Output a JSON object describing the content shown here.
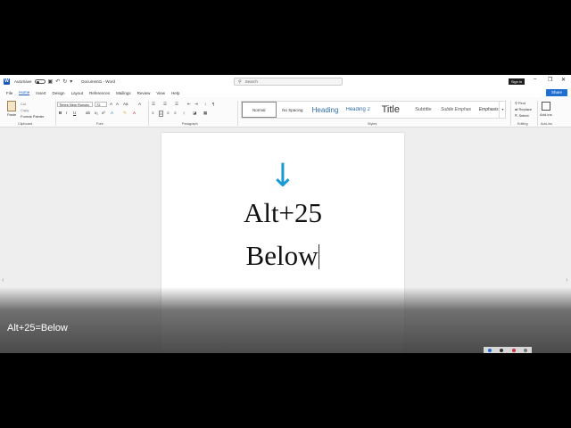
{
  "titlebar": {
    "autosave_label": "AutoSave",
    "doc_title": "Document1 - Word",
    "search_placeholder": "Search",
    "signin_label": "Sign in",
    "minimize": "–",
    "restore": "❐",
    "close": "✕"
  },
  "menu": {
    "items": [
      "File",
      "Home",
      "Insert",
      "Design",
      "Layout",
      "References",
      "Mailings",
      "Review",
      "View",
      "Help"
    ],
    "active": "Home",
    "share_label": "Share"
  },
  "ribbon": {
    "clipboard": {
      "paste": "Paste",
      "cut": "Cut",
      "copy": "Copy",
      "format_painter": "Format Painter",
      "group": "Clipboard"
    },
    "font": {
      "name": "Times New Roman",
      "size": "72",
      "group": "Font",
      "bold": "B",
      "italic": "I",
      "underline": "U"
    },
    "paragraph": {
      "group": "Paragraph"
    },
    "styles": {
      "group": "Styles",
      "items": [
        "Normal",
        "No Spacing",
        "Heading",
        "Heading 2",
        "Title",
        "Subtitle",
        "Subtle Emphas",
        "Emphasis"
      ]
    },
    "editing": {
      "find": "Find",
      "replace": "Replace",
      "select": "Select",
      "group": "Editing"
    },
    "addins": {
      "label": "Add-ins",
      "group": "Add-ins"
    }
  },
  "document": {
    "arrow_symbol": "↓",
    "line1": "Alt+25",
    "line2": "Below"
  },
  "caption": "Alt+25=Below",
  "colors": {
    "word_blue": "#185abd",
    "arrow": "#1b9ad6",
    "share": "#1f6fd1"
  }
}
